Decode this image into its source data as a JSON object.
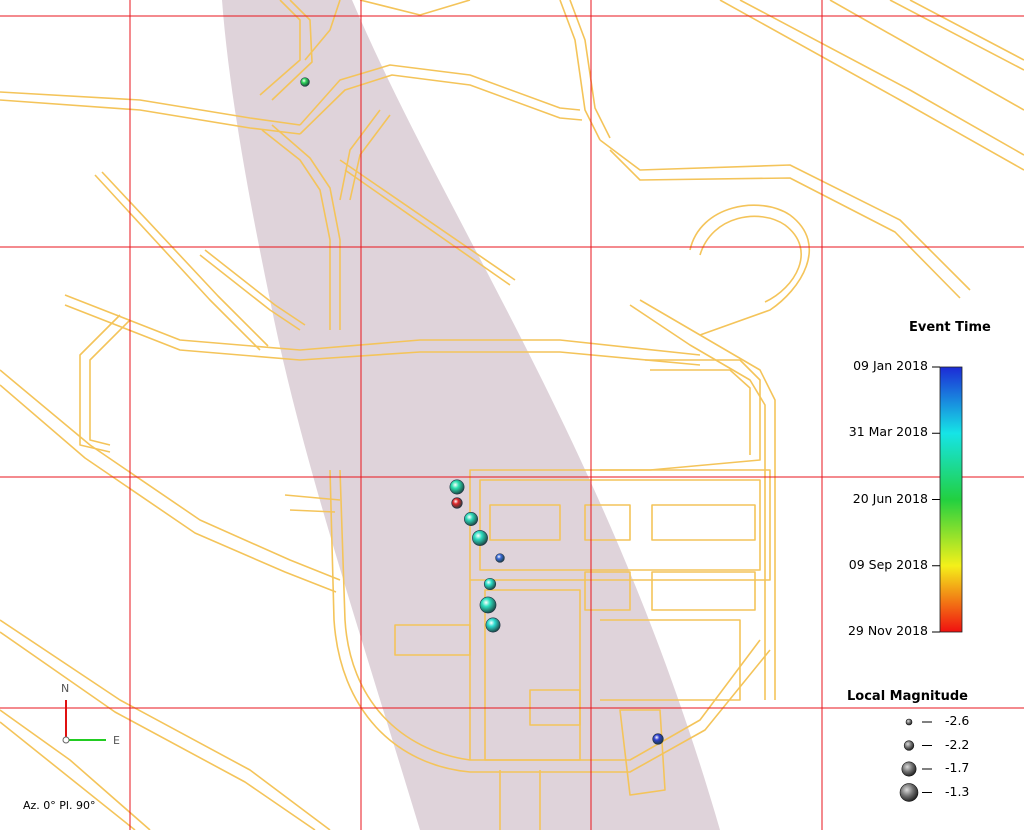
{
  "colors": {
    "background": "#ffffff",
    "grid": "#e8141c",
    "roads": "#f4c45a",
    "swath": "#d9cbd3",
    "colorbar": [
      "#1c2bd6",
      "#16e4e6",
      "#22d040",
      "#f4f01a",
      "#f01010"
    ]
  },
  "event_time_legend": {
    "title": "Event Time",
    "ticks": [
      {
        "label": "09 Jan 2018",
        "fraction": 0.0
      },
      {
        "label": "31 Mar 2018",
        "fraction": 0.25
      },
      {
        "label": "20 Jun 2018",
        "fraction": 0.5
      },
      {
        "label": "09 Sep 2018",
        "fraction": 0.75
      },
      {
        "label": "29 Nov 2018",
        "fraction": 1.0
      }
    ]
  },
  "magnitude_legend": {
    "title": "Local Magnitude",
    "items": [
      {
        "label": "-2.6",
        "magnitude": -2.6
      },
      {
        "label": "-2.2",
        "magnitude": -2.2
      },
      {
        "label": "-1.7",
        "magnitude": -1.7
      },
      {
        "label": "-1.3",
        "magnitude": -1.3
      }
    ]
  },
  "orientation": {
    "north_label": "N",
    "east_label": "E",
    "status": "Az. 0° Pl. 90°"
  },
  "events": [
    {
      "color": "#2ed65a",
      "magnitude": -2.3
    },
    {
      "color": "#2de0b0",
      "magnitude": -1.7
    },
    {
      "color": "#e0262a",
      "magnitude": -2.1
    },
    {
      "color": "#2ed8b8",
      "magnitude": -1.8
    },
    {
      "color": "#2ddcc0",
      "magnitude": -1.6
    },
    {
      "color": "#3a6ad8",
      "magnitude": -2.3
    },
    {
      "color": "#2de0c8",
      "magnitude": -2.0
    },
    {
      "color": "#2ee0c0",
      "magnitude": -1.5
    },
    {
      "color": "#2ddcd0",
      "magnitude": -1.7
    },
    {
      "color": "#3040d0",
      "magnitude": -2.1
    }
  ]
}
